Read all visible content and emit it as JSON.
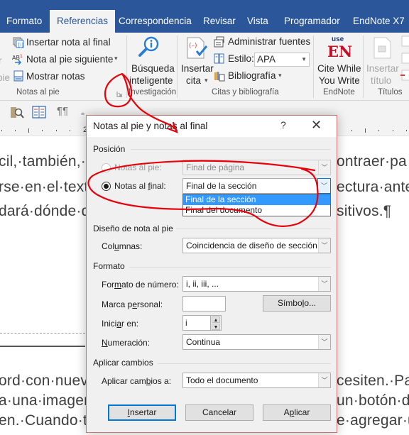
{
  "ribbon": {
    "tabs": [
      {
        "label": "Formato",
        "active": false
      },
      {
        "label": "Referencias",
        "active": true
      },
      {
        "label": "Correspondencia",
        "active": false
      },
      {
        "label": "Revisar",
        "active": false
      },
      {
        "label": "Vista",
        "active": false
      },
      {
        "label": "Programador",
        "active": false
      },
      {
        "label": "EndNote X7",
        "active": false
      }
    ],
    "notas_al_pie": {
      "partial_left_line1": "r",
      "partial_left_line2": "pie",
      "insertar_nota_final": "Insertar nota al final",
      "nota_pie_siguiente": "Nota al pie siguiente",
      "mostrar_notas": "Mostrar notas",
      "group_label": "Notas al pie"
    },
    "investigacion": {
      "busqueda_line1": "Búsqueda",
      "busqueda_line2": "inteligente",
      "group_label": "Investigación"
    },
    "citas": {
      "insertar_line1": "Insertar",
      "insertar_line2": "cita",
      "administrar_fuentes": "Administrar fuentes",
      "estilo_label": "Estilo:",
      "estilo_value": "APA",
      "bibliografia": "Bibliografía",
      "group_label": "Citas y bibliografía"
    },
    "endnote": {
      "logo_top": "use",
      "logo_main": "EN",
      "cite_line1": "Cite While",
      "cite_line2": "You Write",
      "group_label": "EndNote"
    },
    "titulos": {
      "insertar_line1": "Insertar",
      "insertar_line2": "título",
      "group_label": "Títulos"
    }
  },
  "ruler": {
    "number": "2"
  },
  "document": {
    "lines_top": [
      {
        "left": "cil,·también,·",
        "right": "ontraer·pa"
      },
      {
        "left": "rse·en·el·text",
        "right": "ectura·ante"
      },
      {
        "left": "dará·dónde·d",
        "right": "sitivos.¶"
      }
    ],
    "lines_bottom": [
      {
        "left": "ord·con·nuevo",
        "right": "cesiten.·Para"
      },
      {
        "left": "a·una·imagen·",
        "right": "un·botón·de"
      },
      {
        "left": "en.·Cuando·tra",
        "right": "e·agregar·un"
      }
    ]
  },
  "dialog": {
    "title": "Notas al pie y notas al final",
    "help": "?",
    "close": "✕",
    "posicion": {
      "section": "Posición",
      "notas_pie_label": "Notas al pie:",
      "notas_pie_value": "Final de página",
      "notas_pie_checked": false,
      "notas_final_label_pre": "Notas al ",
      "notas_final_label_u": "f",
      "notas_final_label_post": "inal:",
      "notas_final_value": "Final de la sección",
      "notas_final_checked": true,
      "dropdown_options": [
        "Final de la sección",
        "Final del documento"
      ],
      "dropdown_selected_index": 0
    },
    "diseno": {
      "section": "Diseño de nota al pie",
      "columnas_pre": "Col",
      "columnas_u": "u",
      "columnas_post": "mnas:",
      "columnas_value": "Coincidencia de diseño de sección"
    },
    "formato": {
      "section": "Formato",
      "numero_pre": "For",
      "numero_u": "m",
      "numero_post": "ato de número:",
      "numero_value": "i, ii, iii, ...",
      "marca_pre": "Marca p",
      "marca_u": "e",
      "marca_post": "rsonal:",
      "marca_value": "",
      "simbolo_pre": "Símbo",
      "simbolo_u": "l",
      "simbolo_post": "o...",
      "iniciar_pre": "Inici",
      "iniciar_u": "a",
      "iniciar_post": "r en:",
      "iniciar_value": "i",
      "numeracion_u": "N",
      "numeracion_post": "umeración:",
      "numeracion_value": "Continua"
    },
    "aplicar": {
      "section": "Aplicar cambios",
      "label_pre": "Aplicar cam",
      "label_u": "b",
      "label_post": "ios a:",
      "value": "Todo el documento"
    },
    "buttons": {
      "insertar_u": "I",
      "insertar_post": "nsertar",
      "cancelar": "Cancelar",
      "aplicar_pre": "A",
      "aplicar_u": "p",
      "aplicar_post": "licar"
    }
  },
  "colors": {
    "word_blue": "#2b579a",
    "annotation_red": "#e8000b",
    "selection_blue": "#3399ff",
    "focus_blue": "#0078d7"
  }
}
